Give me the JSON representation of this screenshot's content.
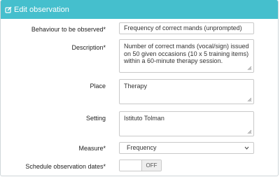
{
  "header": {
    "title": "Edit observation",
    "icon": "pencil-icon"
  },
  "form": {
    "behaviour": {
      "label": "Behaviour to be observed*",
      "value": "Frequency of correct mands (unprompted)"
    },
    "description": {
      "label": "Description*",
      "lines": [
        "Number of correct mands (vocal/sign) issued",
        "on 50 given occasions (10 x 5 training items)",
        "within a 60-minute therapy session."
      ]
    },
    "place": {
      "label": "Place",
      "value": "Therapy"
    },
    "setting": {
      "label": "Setting",
      "value": "Istituto Tolman"
    },
    "measure": {
      "label": "Measure*",
      "value": "Frequency"
    },
    "schedule": {
      "label": "Schedule observation dates*",
      "state": "OFF"
    }
  },
  "colors": {
    "header": "#45bfcd",
    "border": "#c9c9c9"
  }
}
